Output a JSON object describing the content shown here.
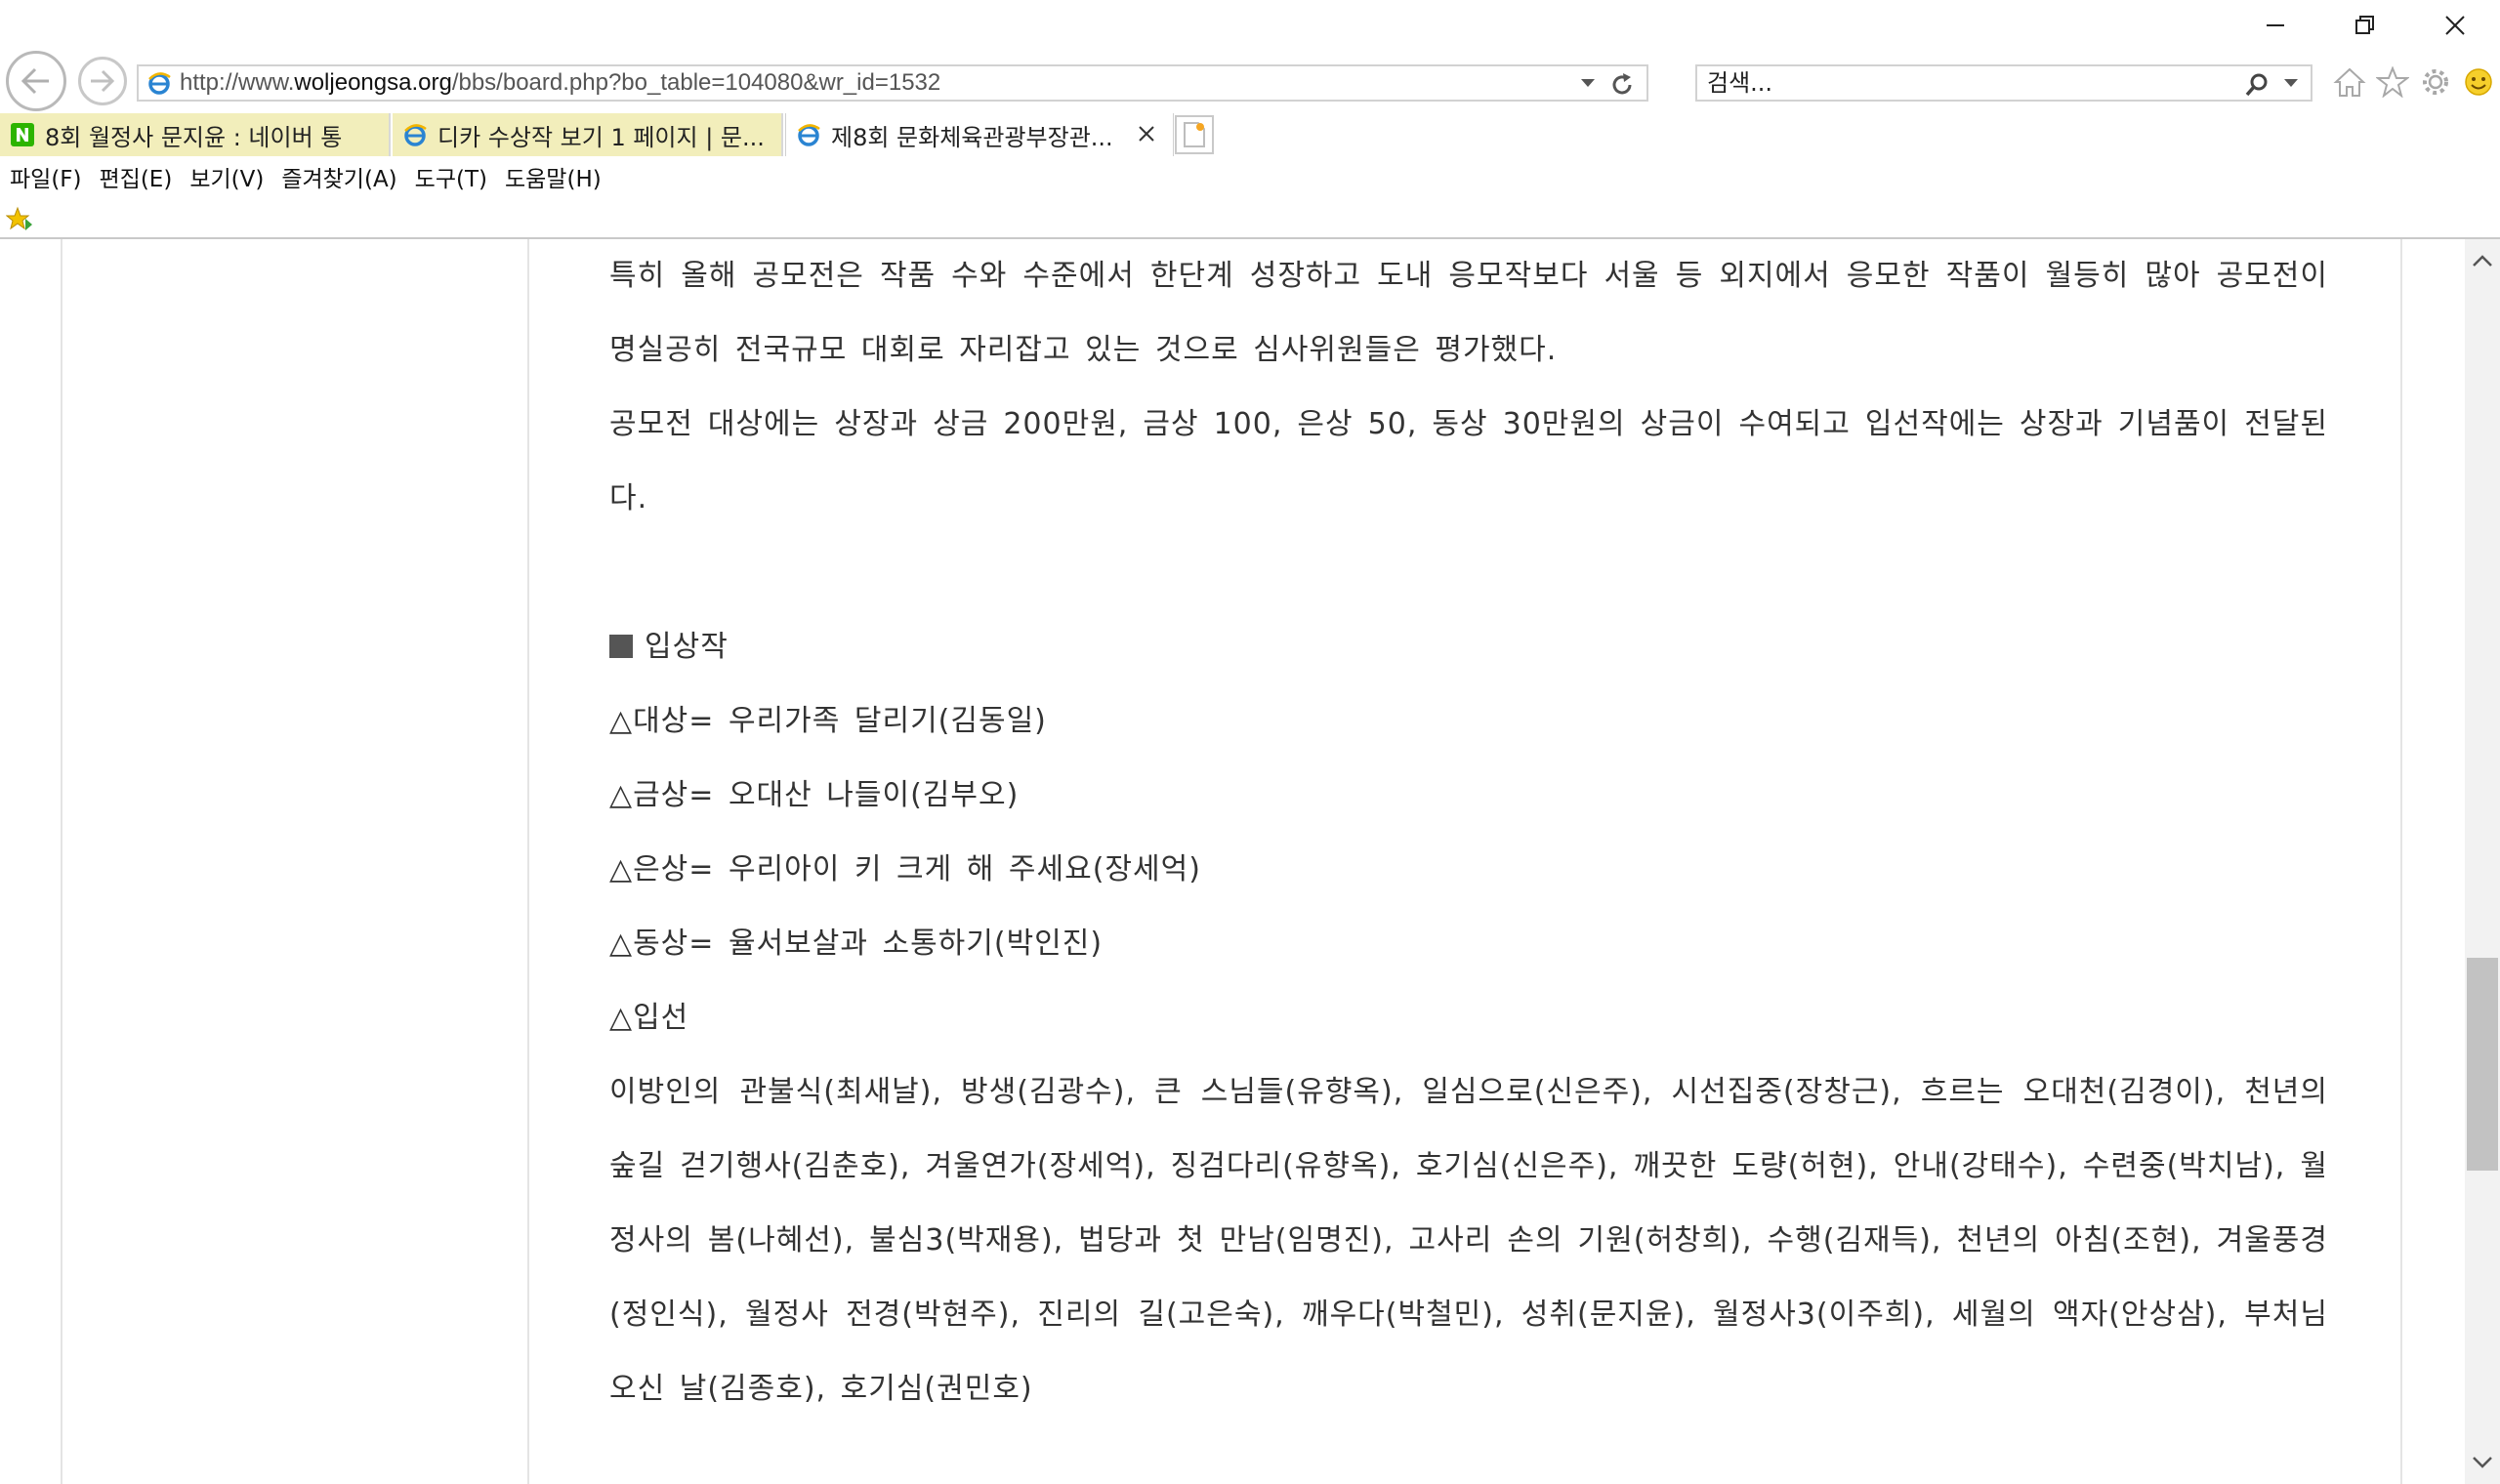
{
  "browser": {
    "address": {
      "url_prefix": "http://www.",
      "url_domain": "woljeongsa.org",
      "url_path": "/bbs/board.php?bo_table=104080&wr_id=1532"
    },
    "search": {
      "placeholder": "검색..."
    },
    "tabs": [
      {
        "label": "8회 월정사 문지윤 : 네이버 통",
        "icon": "naver-icon"
      },
      {
        "label": "디카 수상작 보기 1 페이지 | 문...",
        "icon": "ie-icon"
      },
      {
        "label": "제8회 문화체육관광부장관...",
        "icon": "ie-icon"
      }
    ],
    "menu": [
      "파일(F)",
      "편집(E)",
      "보기(V)",
      "즐겨찾기(A)",
      "도구(T)",
      "도움말(H)"
    ],
    "icons": [
      "back-icon",
      "forward-icon",
      "refresh-icon",
      "search-icon",
      "home-icon",
      "favorites-star-icon",
      "settings-gear-icon",
      "smiley-feedback-icon"
    ]
  },
  "article": {
    "para1": "특히 올해 공모전은 작품 수와 수준에서 한단계 성장하고 도내 응모작보다 서울 등 외지에서 응모한 작품이 월등히 많아 공모전이 명실공히 전국규모 대회로 자리잡고 있는 것으로 심사위원들은 평가했다.",
    "para2": "공모전 대상에는 상장과 상금 200만원, 금상 100, 은상 50, 동상 30만원의 상금이 수여되고 입선작에는 상장과 기념품이 전달된다.",
    "winners_heading": "입상작",
    "grand": "△대상= 우리가족 달리기(김동일)",
    "gold": "△금상= 오대산 나들이(김부오)",
    "silver": "△은상= 우리아이 키 크게 해 주세요(장세억)",
    "bronze": "△동상= 율서보살과 소통하기(박인진)",
    "honorable_heading": "△입선",
    "honorable_list": "이방인의 관불식(최새날), 방생(김광수), 큰 스님들(유향옥), 일심으로(신은주), 시선집중(장창근), 흐르는 오대천(김경이), 천년의 숲길 걷기행사(김춘호), 겨울연가(장세억), 징검다리(유향옥), 호기심(신은주), 깨끗한 도량(허현), 안내(강태수), 수련중(박치남), 월정사의 봄(나혜선), 불심3(박재용), 법당과 첫 만남(임명진), 고사리 손의 기원(허창희), 수행(김재득), 천년의 아침(조현), 겨울풍경(정인식), 월정사 전경(박현주), 진리의 길(고은숙), 깨우다(박철민), 성취(문지윤), 월정사3(이주희), 세월의 액자(안상삼), 부처님 오신 날(김종호), 호기심(권민호)"
  }
}
